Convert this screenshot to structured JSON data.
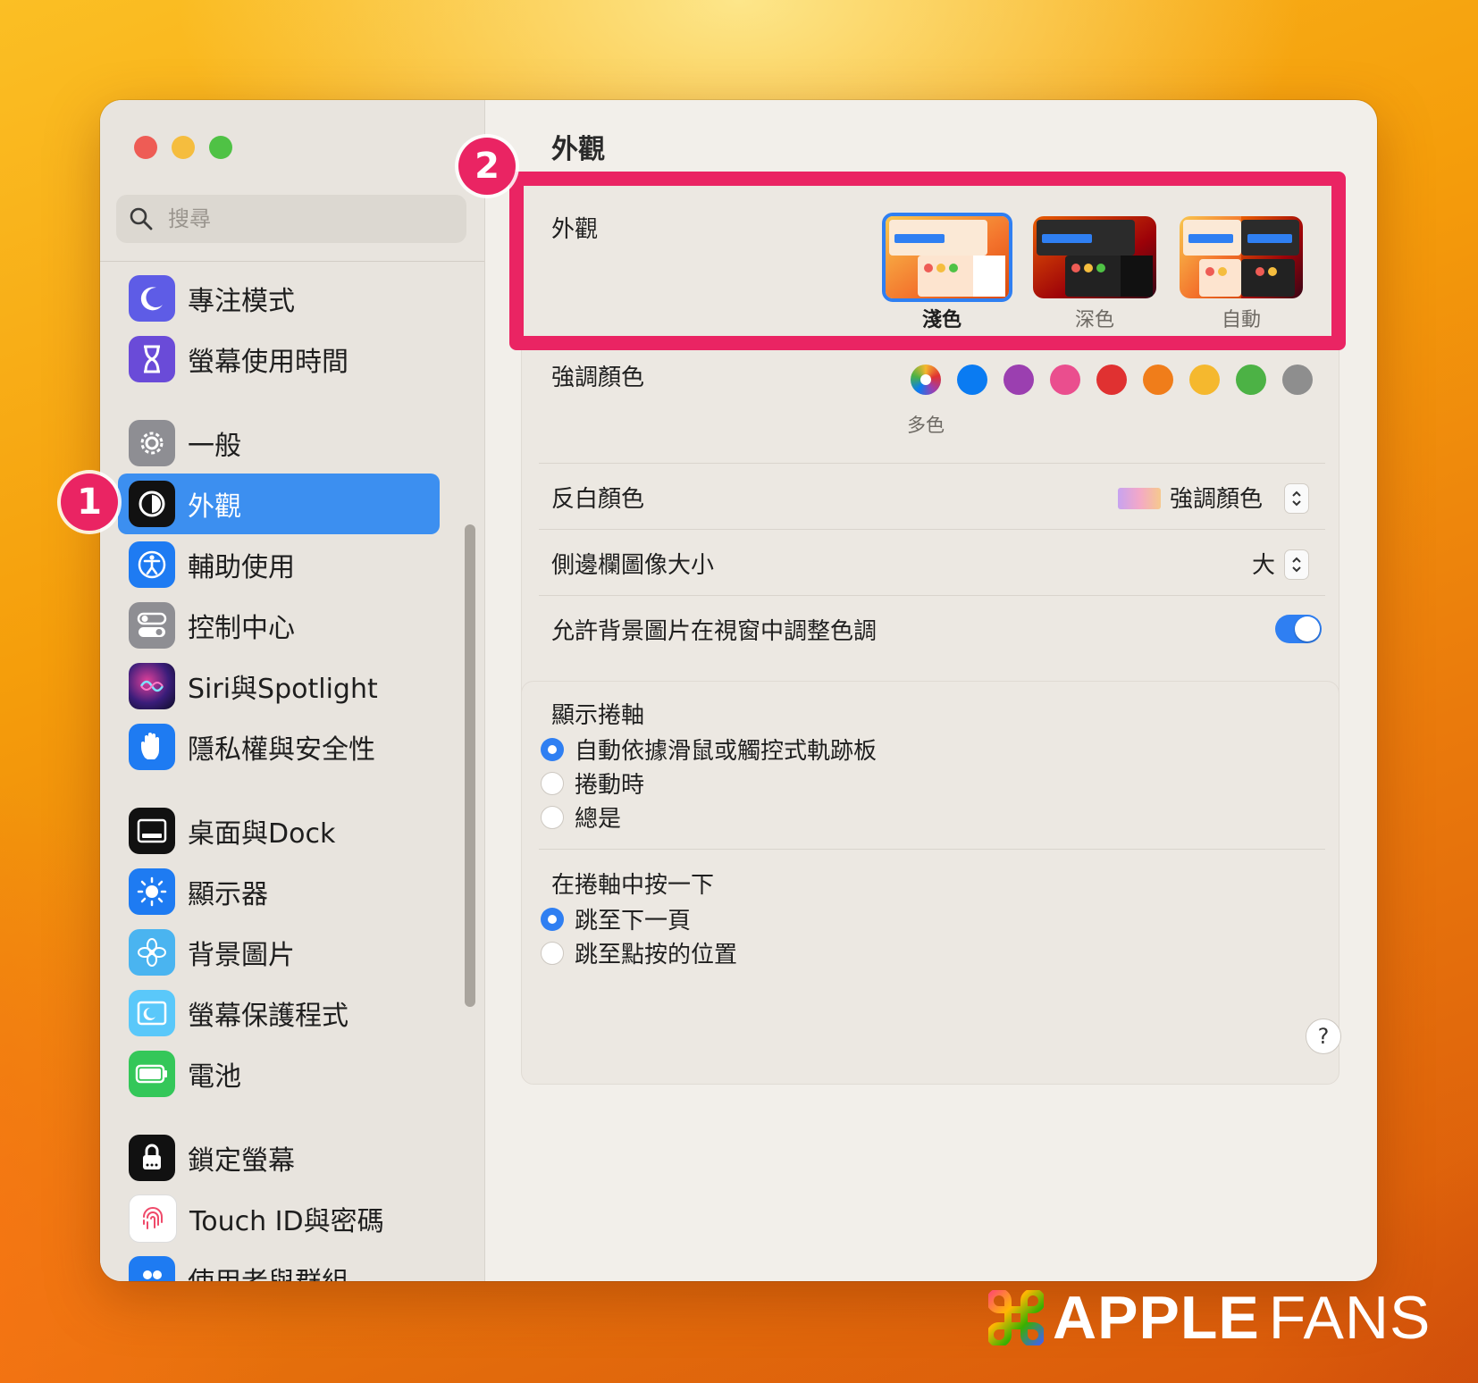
{
  "sidebar": {
    "search_placeholder": "搜尋",
    "items": [
      {
        "label": "專注模式"
      },
      {
        "label": "螢幕使用時間"
      },
      {
        "label": "一般"
      },
      {
        "label": "外觀"
      },
      {
        "label": "輔助使用"
      },
      {
        "label": "控制中心"
      },
      {
        "label": "Siri與Spotlight"
      },
      {
        "label": "隱私權與安全性"
      },
      {
        "label": "桌面與Dock"
      },
      {
        "label": "顯示器"
      },
      {
        "label": "背景圖片"
      },
      {
        "label": "螢幕保護程式"
      },
      {
        "label": "電池"
      },
      {
        "label": "鎖定螢幕"
      },
      {
        "label": "Touch ID與密碼"
      },
      {
        "label": "使用者與群組"
      }
    ],
    "selected": "外觀"
  },
  "annotations": {
    "badge_1": "1",
    "badge_2": "2"
  },
  "main": {
    "title": "外觀",
    "appearance": {
      "label": "外觀",
      "options": [
        {
          "label": "淺色",
          "selected": true
        },
        {
          "label": "深色",
          "selected": false
        },
        {
          "label": "自動",
          "selected": false
        }
      ]
    },
    "accent": {
      "label": "強調顏色",
      "selected_label": "多色",
      "colors": [
        "multicolor",
        "#0a7bf2",
        "#9b3fb0",
        "#ea4e8e",
        "#e03131",
        "#f07d1a",
        "#f5b82e",
        "#4cb245",
        "#8e8e8e"
      ]
    },
    "highlight": {
      "label": "反白顏色",
      "value": "強調顏色"
    },
    "sidebar_icon_size": {
      "label": "側邊欄圖像大小",
      "value": "大"
    },
    "wallpaper_tinting": {
      "label": "允許背景圖片在視窗中調整色調",
      "enabled": true
    },
    "show_scrollbars": {
      "label": "顯示捲軸",
      "options": [
        {
          "label": "自動依據滑鼠或觸控式軌跡板",
          "selected": true
        },
        {
          "label": "捲動時",
          "selected": false
        },
        {
          "label": "總是",
          "selected": false
        }
      ]
    },
    "click_scrollbar": {
      "label": "在捲軸中按一下",
      "options": [
        {
          "label": "跳至下一頁",
          "selected": true
        },
        {
          "label": "跳至點按的位置",
          "selected": false
        }
      ]
    },
    "help_label": "?"
  },
  "watermark": {
    "bold": "APPLE",
    "thin": "FANS"
  }
}
